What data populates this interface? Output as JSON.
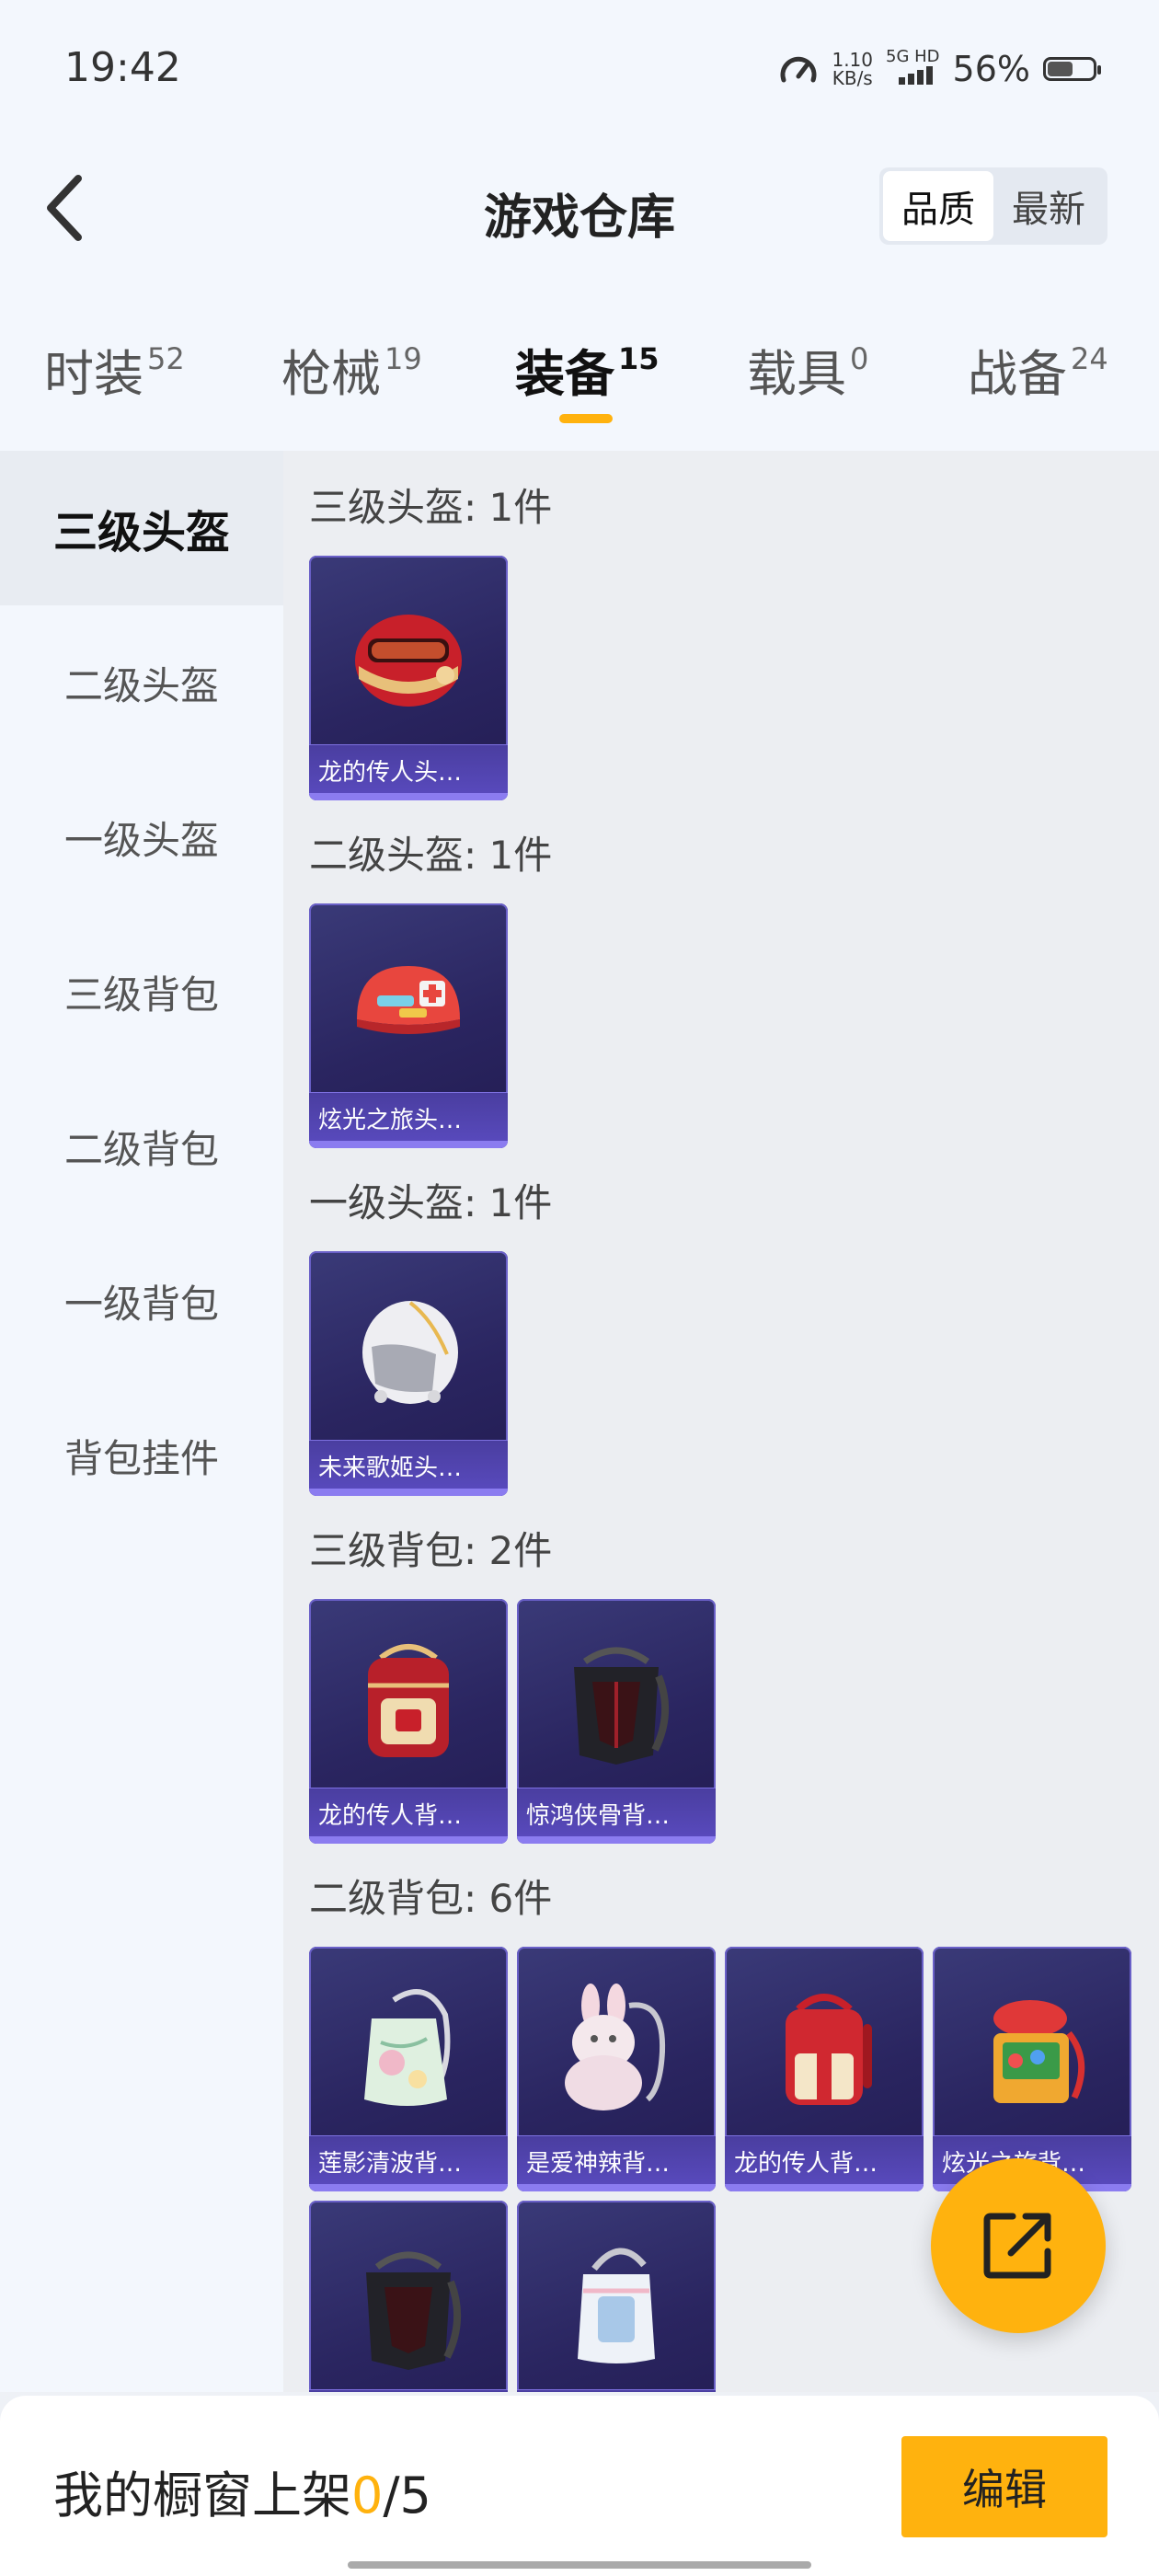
{
  "status_bar": {
    "time": "19:42",
    "net_speed_value": "1.10",
    "net_speed_unit": "KB/s",
    "network": "5G HD",
    "battery_percent": "56%",
    "battery_level": 0.56
  },
  "header": {
    "title": "游戏仓库",
    "back_icon": "chevron-left-icon",
    "sort_options": [
      "品质",
      "最新"
    ],
    "sort_active": "品质"
  },
  "tabs": [
    {
      "label": "时装",
      "count": "52"
    },
    {
      "label": "枪械",
      "count": "19"
    },
    {
      "label": "装备",
      "count": "15",
      "active": true
    },
    {
      "label": "载具",
      "count": "0"
    },
    {
      "label": "战备",
      "count": "24"
    }
  ],
  "sidebar": {
    "items": [
      "三级头盔",
      "二级头盔",
      "一级头盔",
      "三级背包",
      "二级背包",
      "一级背包",
      "背包挂件"
    ],
    "active": "三级头盔"
  },
  "groups": [
    {
      "title": "三级头盔: 1件",
      "items": [
        {
          "name": "龙的传人头…",
          "icon": "helmet-icon"
        }
      ]
    },
    {
      "title": "二级头盔: 1件",
      "items": [
        {
          "name": "炫光之旅头…",
          "icon": "helmet-icon"
        }
      ]
    },
    {
      "title": "一级头盔: 1件",
      "items": [
        {
          "name": "未来歌姬头…",
          "icon": "helmet-icon"
        }
      ]
    },
    {
      "title": "三级背包: 2件",
      "items": [
        {
          "name": "龙的传人背…",
          "icon": "backpack-icon"
        },
        {
          "name": "惊鸿侠骨背…",
          "icon": "backpack-icon"
        }
      ]
    },
    {
      "title": "二级背包: 6件",
      "items": [
        {
          "name": "莲影清波背…",
          "icon": "backpack-icon"
        },
        {
          "name": "是爱神辣背…",
          "icon": "backpack-icon"
        },
        {
          "name": "龙的传人背…",
          "icon": "backpack-icon"
        },
        {
          "name": "炫光之旅背…",
          "icon": "backpack-icon"
        },
        {
          "name": "",
          "icon": "backpack-icon"
        },
        {
          "name": "",
          "icon": "backpack-icon"
        }
      ]
    }
  ],
  "colors": {
    "accent": "#ffb20e",
    "card_bg": "#2a2560",
    "card_label_bg": "#5a4bc0"
  },
  "fab": {
    "icon": "share-icon"
  },
  "bottom_bar": {
    "label": "我的橱窗上架",
    "count": "0",
    "total": "/5",
    "edit_label": "编辑"
  }
}
